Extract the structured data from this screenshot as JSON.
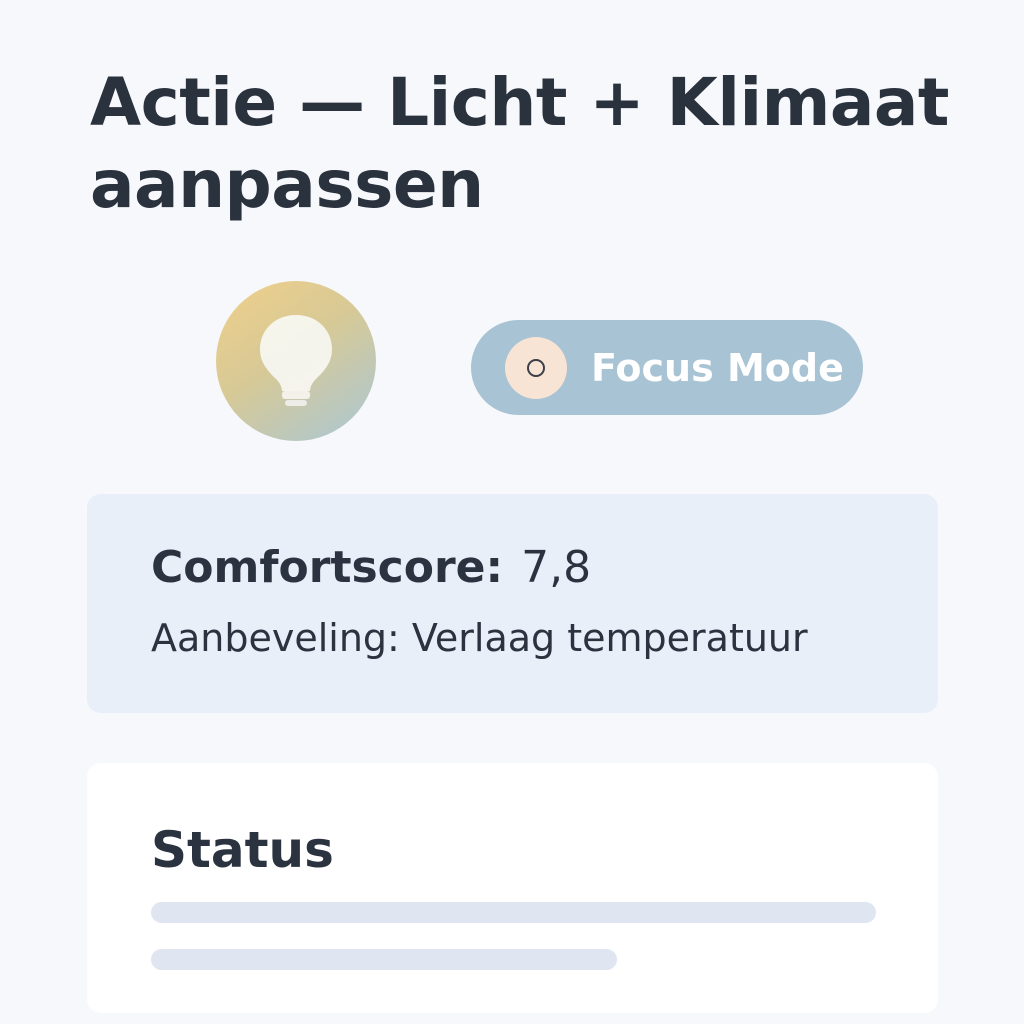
{
  "header": {
    "title": "Actie — Licht + Klimaat aanpassen"
  },
  "controls": {
    "bulb_icon": "lightbulb-icon",
    "focus_toggle": {
      "label": "Focus Mode",
      "icon": "circle-icon"
    }
  },
  "comfort": {
    "score_label": "Comfortscore:",
    "score_value": "7,8",
    "recommendation_label": "Aanbeveling:",
    "recommendation_value": "Verlaag temperatuur"
  },
  "status": {
    "title": "Status"
  },
  "colors": {
    "background": "#f6f8fb",
    "toggle": "#a8c3d4",
    "comfort_card": "#e8eff9",
    "skeleton": "#dfe6f1"
  }
}
